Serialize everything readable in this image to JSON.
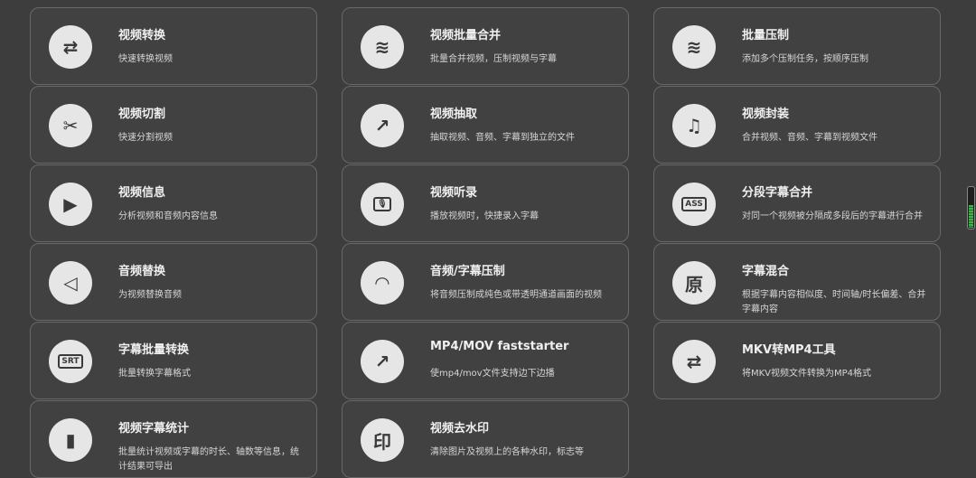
{
  "tools": [
    {
      "title": "视频转换",
      "desc": "快速转换视频",
      "icon": "convert-avi-mov-icon",
      "glyph": "⇄"
    },
    {
      "title": "视频批量合并",
      "desc": "批量合并视频，压制视频与字幕",
      "icon": "layers-merge-icon",
      "glyph": "≋"
    },
    {
      "title": "批量压制",
      "desc": "添加多个压制任务，按顺序压制",
      "icon": "layers-compress-icon",
      "glyph": "≋"
    },
    {
      "title": "视频切割",
      "desc": "快速分割视频",
      "icon": "video-cut-icon",
      "glyph": "✂"
    },
    {
      "title": "视频抽取",
      "desc": "抽取视频、音频、字幕到独立的文件",
      "icon": "video-extract-icon",
      "glyph": "↗"
    },
    {
      "title": "视频封装",
      "desc": "合并视频、音频、字幕到视频文件",
      "icon": "video-mux-icon",
      "glyph": "♫"
    },
    {
      "title": "视频信息",
      "desc": "分析视频和音频内容信息",
      "icon": "folder-play-icon",
      "glyph": "▶"
    },
    {
      "title": "视频听录",
      "desc": "播放视频时，快捷录入字幕",
      "icon": "microphone-icon",
      "glyph": "🎙"
    },
    {
      "title": "分段字幕合并",
      "desc": "对同一个视频被分隔成多段后的字幕进行合并",
      "icon": "ass-merge-icon",
      "glyph": "ASS"
    },
    {
      "title": "音频替换",
      "desc": "为视频替换音频",
      "icon": "speaker-replace-icon",
      "glyph": "◁"
    },
    {
      "title": "音频/字幕压制",
      "desc": "将音频压制成纯色或带透明通道画面的视频",
      "icon": "headphones-icon",
      "glyph": "◠"
    },
    {
      "title": "字幕混合",
      "desc": "根据字幕内容相似度、时间轴/时长偏差、合并字幕内容",
      "icon": "subtitle-mix-icon",
      "glyph": "原"
    },
    {
      "title": "字幕批量转换",
      "desc": "批量转换字幕格式",
      "icon": "srt-icon",
      "glyph": "SRT"
    },
    {
      "title": "MP4/MOV faststarter",
      "desc": "使mp4/mov文件支持边下边播",
      "icon": "faststart-icon",
      "glyph": "↗"
    },
    {
      "title": "MKV转MP4工具",
      "desc": "将MKV视频文件转换为MP4格式",
      "icon": "mkv-to-mp4-icon",
      "glyph": "⇄"
    },
    {
      "title": "视频字幕统计",
      "desc": "批量统计视频或字幕的时长、轴数等信息，统计结果可导出",
      "icon": "bar-chart-icon",
      "glyph": "▮"
    },
    {
      "title": "视频去水印",
      "desc": "清除图片及视频上的各种水印，标志等",
      "icon": "watermark-remove-icon",
      "glyph": "印"
    },
    null
  ],
  "scroll_indicator": {
    "level": 0.55,
    "color": "#3fb54a"
  }
}
